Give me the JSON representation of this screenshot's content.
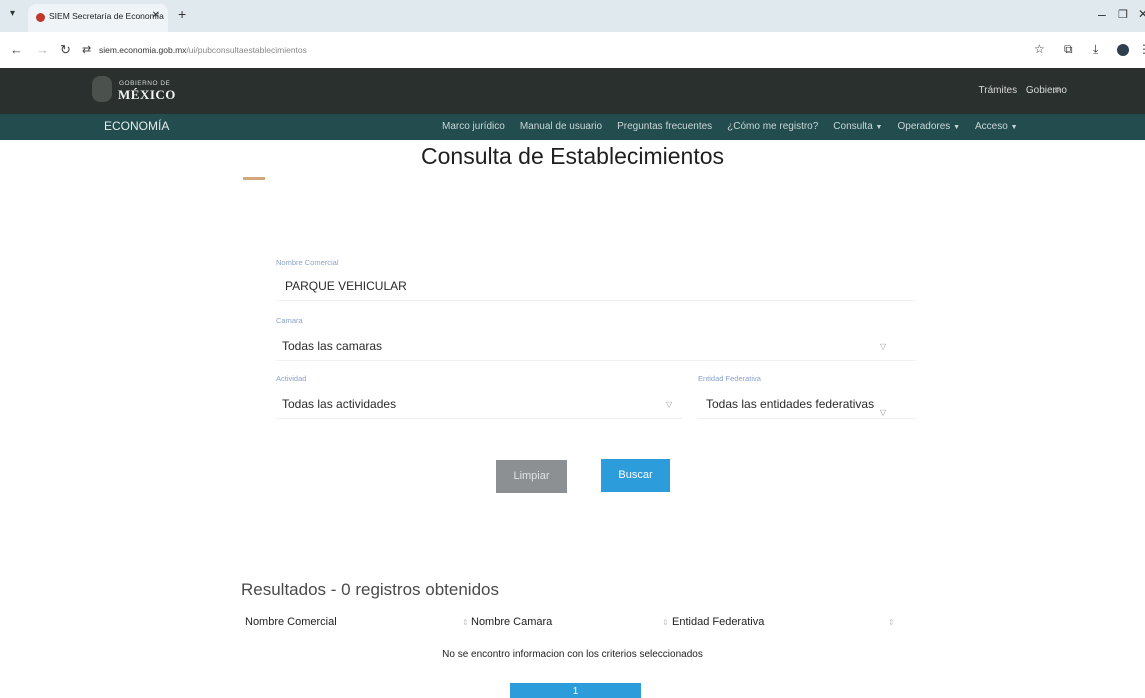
{
  "browser": {
    "tab_title": "SIEM Secretaría de Economía",
    "url_host": "siem.economia.gob.mx",
    "url_path": "/ui/pubconsultaestablecimientos"
  },
  "site": {
    "gob_small": "GOBIERNO DE",
    "gob_big": "MÉXICO",
    "top_links": [
      "Trámites",
      "Gobierno"
    ],
    "section_title": "ECONOMÍA",
    "nav": {
      "marco": "Marco jurídico",
      "manual": "Manual de usuario",
      "preguntas": "Preguntas frecuentes",
      "registro": "¿Cómo me registro?",
      "consulta": "Consulta",
      "operadores": "Operadores",
      "acceso": "Acceso"
    }
  },
  "form": {
    "title": "Consulta de Establecimientos",
    "nombre_label": "Nombre Comercial",
    "nombre_value": "PARQUE VEHICULAR",
    "camara_label": "Camara",
    "camara_value": "Todas las camaras",
    "actividad_label": "Actividad",
    "actividad_value": "Todas las actividades",
    "entidad_label": "Entidad Federativa",
    "entidad_value": "Todas las entidades federativas",
    "limpiar": "Limpiar",
    "buscar": "Buscar"
  },
  "results": {
    "title": "Resultados - 0 registros obtenidos",
    "col1": "Nombre Comercial",
    "col2": "Nombre Camara",
    "col3": "Entidad Federativa",
    "empty": "No se encontro informacion con los criterios seleccionados",
    "page": "1"
  }
}
